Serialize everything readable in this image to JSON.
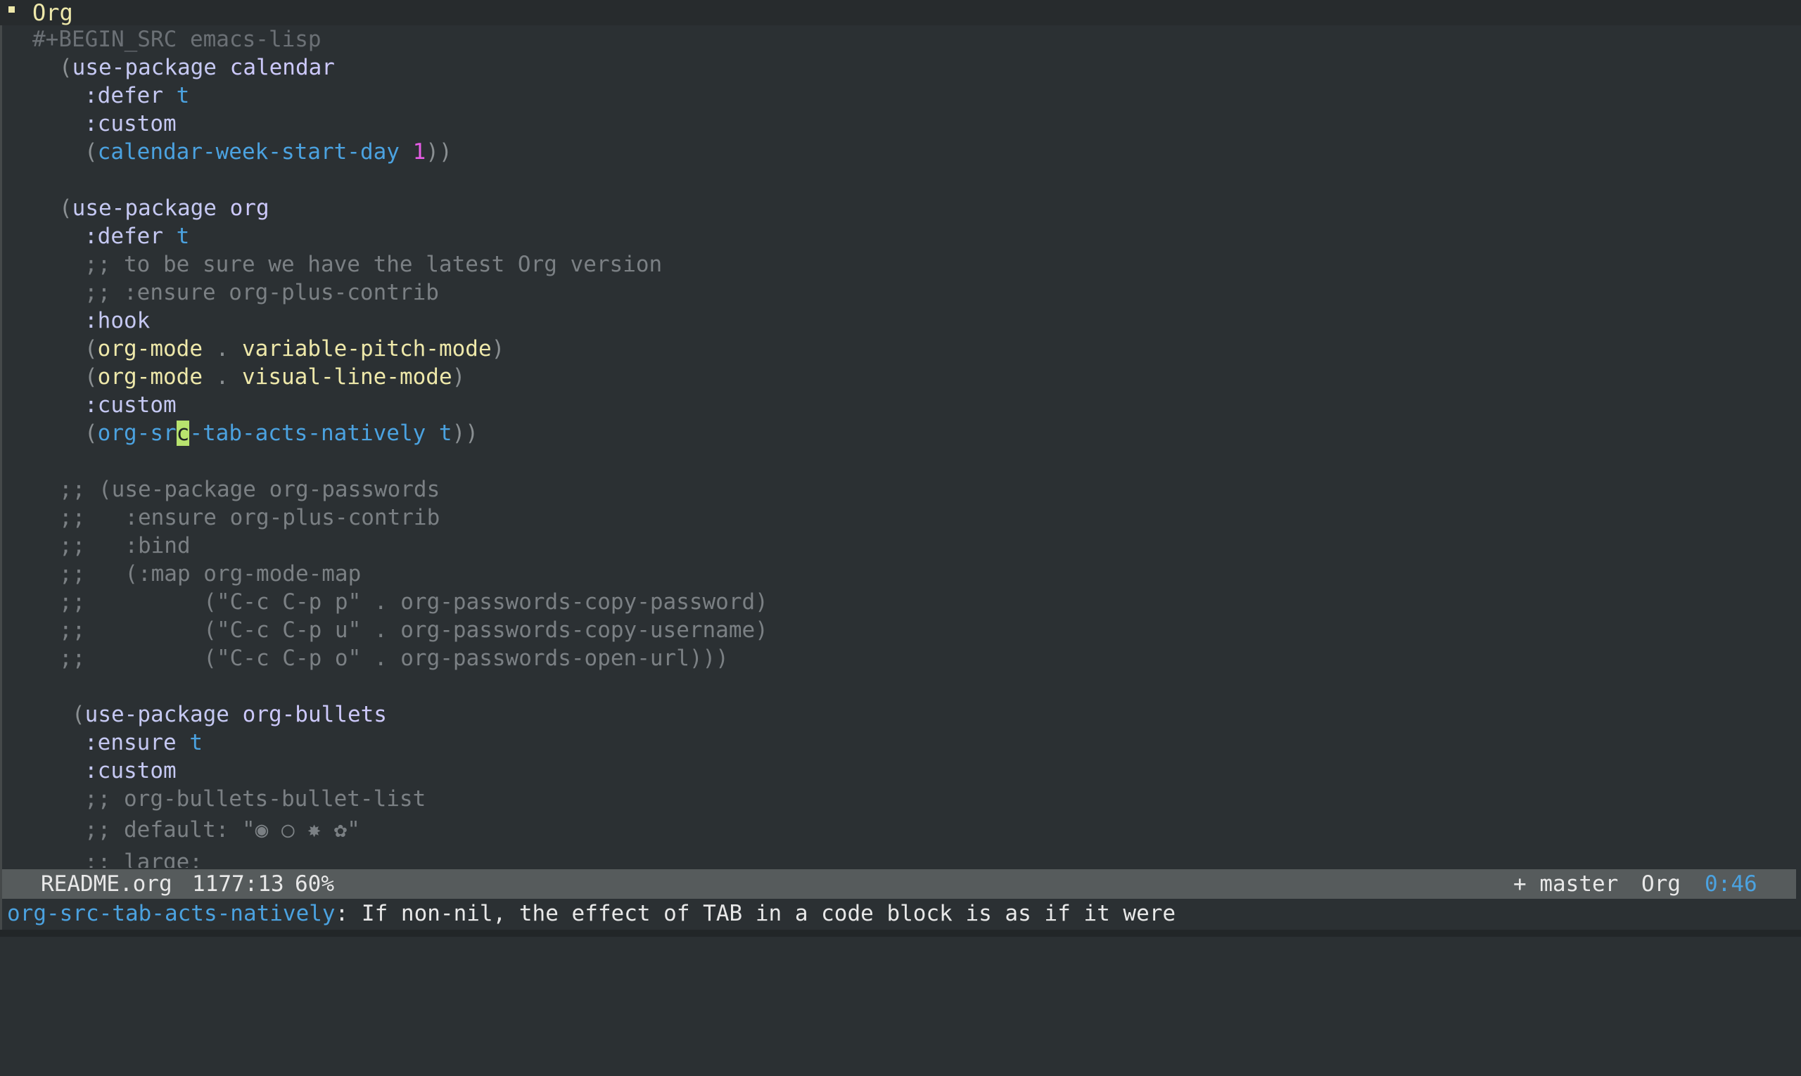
{
  "heading": {
    "title": "Org"
  },
  "code": {
    "begin_src": "#+BEGIN_SRC emacs-lisp",
    "calendar": {
      "open": "(",
      "use_package": "use-package",
      "name": "calendar",
      "defer": ":defer",
      "defer_val": "t",
      "custom": ":custom",
      "var_open": "(",
      "var": "calendar-week-start-day",
      "val": "1",
      "close": "))"
    },
    "org": {
      "open": "(",
      "use_package": "use-package",
      "name": "org",
      "defer": ":defer",
      "defer_val": "t",
      "comment1": ";; to be sure we have the latest Org version",
      "comment2": ";; :ensure org-plus-contrib",
      "hook": ":hook",
      "hook1_open": "(",
      "hook1_mode": "org-mode",
      "hook1_dot": ".",
      "hook1_target": "variable-pitch-mode",
      "hook1_close": ")",
      "hook2_open": "(",
      "hook2_mode": "org-mode",
      "hook2_dot": ".",
      "hook2_target": "visual-line-mode",
      "hook2_close": ")",
      "custom": ":custom",
      "var_open": "(",
      "var_before_cursor": "org-sr",
      "cursor_char": "c",
      "var_after_cursor": "-tab-acts-natively t",
      "close": "))"
    },
    "passwords": [
      ";; (use-package org-passwords",
      ";;   :ensure org-plus-contrib",
      ";;   :bind",
      ";;   (:map org-mode-map",
      ";;         (\"C-c C-p p\" . org-passwords-copy-password)",
      ";;         (\"C-c C-p u\" . org-passwords-copy-username)",
      ";;         (\"C-c C-p o\" . org-passwords-open-url)))"
    ],
    "bullets": {
      "open": "(",
      "use_package": "use-package",
      "name": "org-bullets",
      "ensure": ":ensure",
      "ensure_val": "t",
      "custom": ":custom",
      "comment1": ";; org-bullets-bullet-list",
      "comment2": ";; default: \"◉ ○ ✸ ✿\"",
      "comment3": ";; large:"
    }
  },
  "modeline": {
    "buffer": "README.org",
    "position": "1177:13",
    "percent": "60%",
    "vc": "+ master",
    "mode": "Org",
    "time": "0:46"
  },
  "minibuffer": {
    "symbol": "org-src-tab-acts-natively",
    "message": ": If non-nil, the effect of TAB in a code block is as if it were"
  },
  "colors": {
    "background": "#2b3033",
    "keyword": "#c5c8f2",
    "symbol": "#4ba2e0",
    "number": "#e65ce6",
    "comment": "#7b8084",
    "heading": "#eee8aa",
    "cursor": "#b8e36e",
    "modeline": "#565b5c"
  }
}
